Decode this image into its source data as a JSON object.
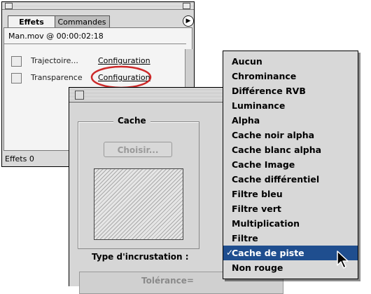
{
  "effets_palette": {
    "tabs": [
      {
        "label": "Effets"
      },
      {
        "label": "Commandes"
      }
    ],
    "clip_info": "Man.mov @ 00:00:02:18",
    "rows": [
      {
        "name": "Trajectoire...",
        "link": "Configuration"
      },
      {
        "name": "Transparence",
        "link": "Configuration"
      }
    ],
    "status": "Effets 0",
    "icons": {
      "menu": "triangle-right-icon"
    }
  },
  "dialog": {
    "group_title": "Cache",
    "choose_button": "Choisir...",
    "type_label": "Type d'incrustation :",
    "tolerance_label": "Tolérance="
  },
  "popup_menu": {
    "items": [
      {
        "label": "Aucun",
        "selected": false
      },
      {
        "label": "Chrominance",
        "selected": false
      },
      {
        "label": "Différence RVB",
        "selected": false
      },
      {
        "label": "Luminance",
        "selected": false
      },
      {
        "label": "Alpha",
        "selected": false
      },
      {
        "label": "Cache noir alpha",
        "selected": false
      },
      {
        "label": "Cache blanc alpha",
        "selected": false
      },
      {
        "label": "Cache Image",
        "selected": false
      },
      {
        "label": "Cache différentiel",
        "selected": false
      },
      {
        "label": "Filtre bleu",
        "selected": false
      },
      {
        "label": "Filtre vert",
        "selected": false
      },
      {
        "label": "Multiplication",
        "selected": false
      },
      {
        "label": "Filtre",
        "selected": false
      },
      {
        "label": "Cache de piste",
        "selected": true
      },
      {
        "label": "Non rouge",
        "selected": false
      }
    ],
    "selection_color": "#1f4e8f",
    "check_glyph": "✓"
  },
  "highlight_color": "#cc2a2a"
}
